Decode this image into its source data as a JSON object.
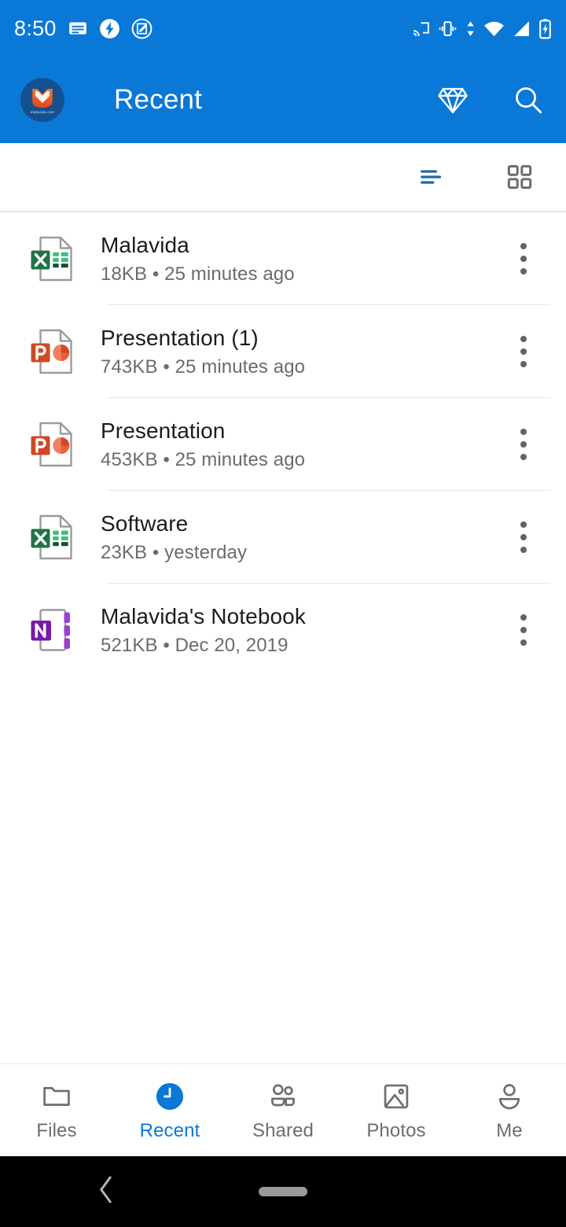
{
  "status_bar": {
    "time": "8:50",
    "left_icons": [
      "subtitles-icon",
      "lightning-badge-icon",
      "screenshot-edit-icon"
    ],
    "right_icons": [
      "cast-icon",
      "vibrate-icon",
      "data-transfer-icon",
      "wifi-icon",
      "signal-icon",
      "battery-charging-icon"
    ]
  },
  "app_bar": {
    "title": "Recent",
    "avatar_label": "malavida.com",
    "avatar_name": "account-avatar",
    "actions": [
      {
        "name": "premium-diamond-button",
        "icon": "diamond-icon"
      },
      {
        "name": "search-button",
        "icon": "search-icon"
      }
    ]
  },
  "view_toolbar": {
    "list_view": {
      "label": "List view",
      "icon": "list-view-icon",
      "active": true
    },
    "grid_view": {
      "label": "Grid view",
      "icon": "grid-view-icon",
      "active": false
    }
  },
  "files": [
    {
      "name": "Malavida",
      "size": "18KB",
      "modified": "25 minutes ago",
      "meta": "18KB • 25 minutes ago",
      "type": "excel",
      "icon": "excel-file-icon"
    },
    {
      "name": "Presentation (1)",
      "size": "743KB",
      "modified": "25 minutes ago",
      "meta": "743KB • 25 minutes ago",
      "type": "powerpoint",
      "icon": "powerpoint-file-icon"
    },
    {
      "name": "Presentation",
      "size": "453KB",
      "modified": "25 minutes ago",
      "meta": "453KB • 25 minutes ago",
      "type": "powerpoint",
      "icon": "powerpoint-file-icon"
    },
    {
      "name": "Software",
      "size": "23KB",
      "modified": "yesterday",
      "meta": "23KB • yesterday",
      "type": "excel",
      "icon": "excel-file-icon"
    },
    {
      "name": "Malavida's Notebook",
      "size": "521KB",
      "modified": "Dec 20, 2019",
      "meta": "521KB • Dec 20, 2019",
      "type": "onenote",
      "icon": "onenote-file-icon"
    }
  ],
  "row_menu": {
    "name": "more-options-button",
    "icon": "overflow-menu-icon"
  },
  "bottom_nav": {
    "items": [
      {
        "label": "Files",
        "icon": "folder-icon",
        "active": false
      },
      {
        "label": "Recent",
        "icon": "clock-icon",
        "active": true
      },
      {
        "label": "Shared",
        "icon": "people-icon",
        "active": false
      },
      {
        "label": "Photos",
        "icon": "picture-icon",
        "active": false
      },
      {
        "label": "Me",
        "icon": "person-icon",
        "active": false
      }
    ]
  },
  "system_nav": {
    "back": "back-chevron-icon",
    "home": "home-pill-indicator"
  },
  "colors": {
    "brand_blue": "#0a78d6",
    "accent_blue": "#0a78d6",
    "excel_green": "#217346",
    "powerpoint_orange": "#d24726",
    "onenote_purple": "#7719aa",
    "text_primary": "#1c1c1c",
    "text_secondary": "#6b6b6b",
    "divider": "#e8e8e8",
    "system_nav_bg": "#000000"
  }
}
